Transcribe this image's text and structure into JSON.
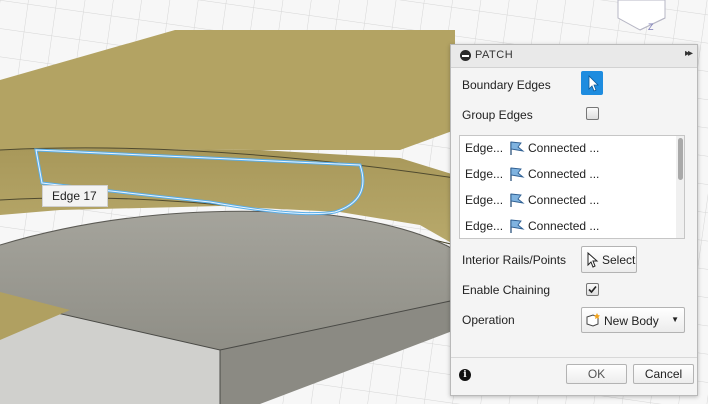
{
  "tooltip": {
    "text": "Edge 17"
  },
  "viewcube": {
    "axis_label": "Z"
  },
  "panel": {
    "title": "PATCH",
    "expand_icon": "double-chevron-right-icon",
    "boundary_edges": {
      "label": "Boundary Edges",
      "icon": "cursor-arrow-icon",
      "active": true
    },
    "group_edges": {
      "label": "Group Edges",
      "checked": false
    },
    "edge_list": [
      {
        "name": "Edge...",
        "icon": "flag-icon",
        "type": "Connected ..."
      },
      {
        "name": "Edge...",
        "icon": "flag-icon",
        "type": "Connected ..."
      },
      {
        "name": "Edge...",
        "icon": "flag-icon",
        "type": "Connected ..."
      },
      {
        "name": "Edge...",
        "icon": "flag-icon",
        "type": "Connected ..."
      }
    ],
    "interior_rails": {
      "label": "Interior Rails/Points",
      "button_label": "Select"
    },
    "enable_chaining": {
      "label": "Enable Chaining",
      "checked": true
    },
    "operation": {
      "label": "Operation",
      "value": "New Body"
    },
    "ok_label": "OK",
    "cancel_label": "Cancel"
  },
  "colors": {
    "accent": "#1e8cdf",
    "model_tan": "#b3a363",
    "model_gray": "#9b9a92",
    "selection_outline": "#5aaee8"
  }
}
